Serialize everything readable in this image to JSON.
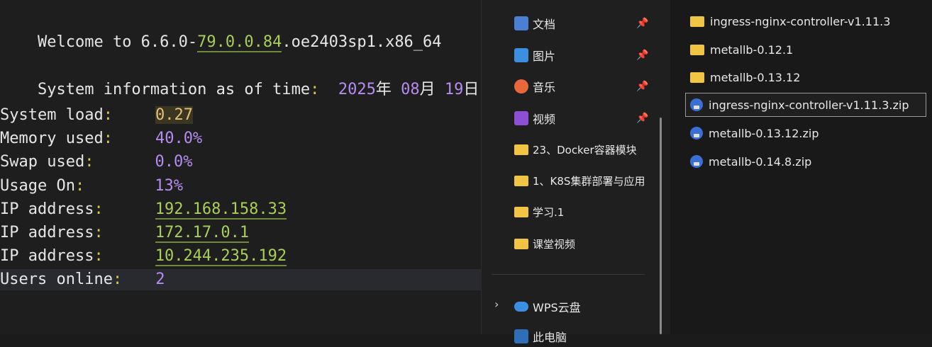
{
  "terminal": {
    "welcome_prefix": "Welcome to 6.6.0-",
    "welcome_version": "79.0.0.84",
    "welcome_suffix": ".oe2403sp1.x86_64",
    "sysinfo_label": "System information as of time",
    "sysinfo_colon": ":",
    "sysinfo_year": "2025",
    "sysinfo_y": "年 ",
    "sysinfo_month": "08",
    "sysinfo_m": "月 ",
    "sysinfo_day": "19",
    "sysinfo_d": "日",
    "rows": [
      {
        "label": "System load",
        "value": "0.27"
      },
      {
        "label": "Memory used",
        "value": "40.0%"
      },
      {
        "label": "Swap used",
        "value": "0.0%"
      },
      {
        "label": "Usage On",
        "value": "13%"
      },
      {
        "label": "IP address",
        "value": "192.168.158.33"
      },
      {
        "label": "IP address",
        "value": "172.17.0.1"
      },
      {
        "label": "IP address",
        "value": "10.244.235.192"
      },
      {
        "label": "Users online",
        "value": "2"
      }
    ],
    "colon": ":"
  },
  "nav": {
    "items": [
      {
        "label": "文档",
        "icon": "document-icon",
        "pinned": true
      },
      {
        "label": "图片",
        "icon": "pictures-icon",
        "pinned": true
      },
      {
        "label": "音乐",
        "icon": "music-icon",
        "pinned": true
      },
      {
        "label": "视频",
        "icon": "videos-icon",
        "pinned": true
      },
      {
        "label": "23、Docker容器模块",
        "icon": "folder-icon",
        "pinned": false
      },
      {
        "label": "1、K8S集群部署与应用",
        "icon": "folder-icon",
        "pinned": false
      },
      {
        "label": "学习.1",
        "icon": "folder-icon",
        "pinned": false
      },
      {
        "label": "课堂视频",
        "icon": "folder-icon",
        "pinned": false
      }
    ],
    "cloud": {
      "label": "WPS云盘",
      "icon": "cloud-icon"
    },
    "partial": {
      "label": "此电脑"
    },
    "pin_glyph": "📌",
    "chevron_glyph": "›"
  },
  "files": {
    "items": [
      {
        "name": "ingress-nginx-controller-v1.11.3",
        "type": "folder"
      },
      {
        "name": "metallb-0.12.1",
        "type": "folder"
      },
      {
        "name": "metallb-0.13.12",
        "type": "folder"
      },
      {
        "name": "ingress-nginx-controller-v1.11.3.zip",
        "type": "zip",
        "selected": true
      },
      {
        "name": "metallb-0.13.12.zip",
        "type": "zip"
      },
      {
        "name": "metallb-0.14.8.zip",
        "type": "zip"
      }
    ]
  },
  "colors": {
    "terminal_bg": "#1e1e1e",
    "label_colon": "#d7c94b",
    "value_purple": "#b58cf0",
    "value_green": "#a8cf5a",
    "value_yellow": "#e5c07b",
    "folder": "#f2c443"
  }
}
